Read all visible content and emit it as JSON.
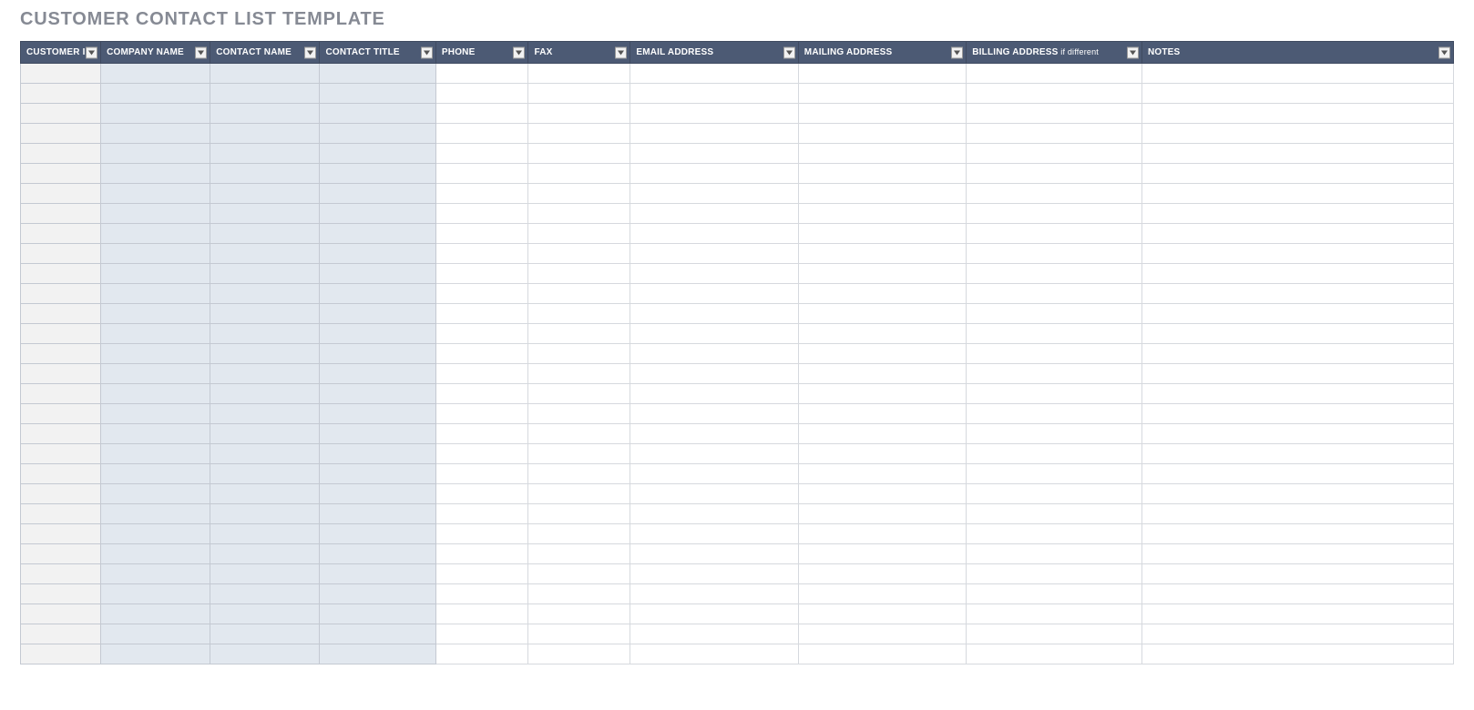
{
  "title": "CUSTOMER CONTACT LIST TEMPLATE",
  "columns": {
    "customer_id": "CUSTOMER ID",
    "company_name": "COMPANY NAME",
    "contact_name": "CONTACT NAME",
    "contact_title": "CONTACT TITLE",
    "phone": "PHONE",
    "fax": "FAX",
    "email_address": "EMAIL ADDRESS",
    "mailing_address": "MAILING ADDRESS",
    "billing_address": "BILLING ADDRESS",
    "billing_address_sub": " if different",
    "notes": "NOTES"
  },
  "row_count": 30,
  "rows": []
}
